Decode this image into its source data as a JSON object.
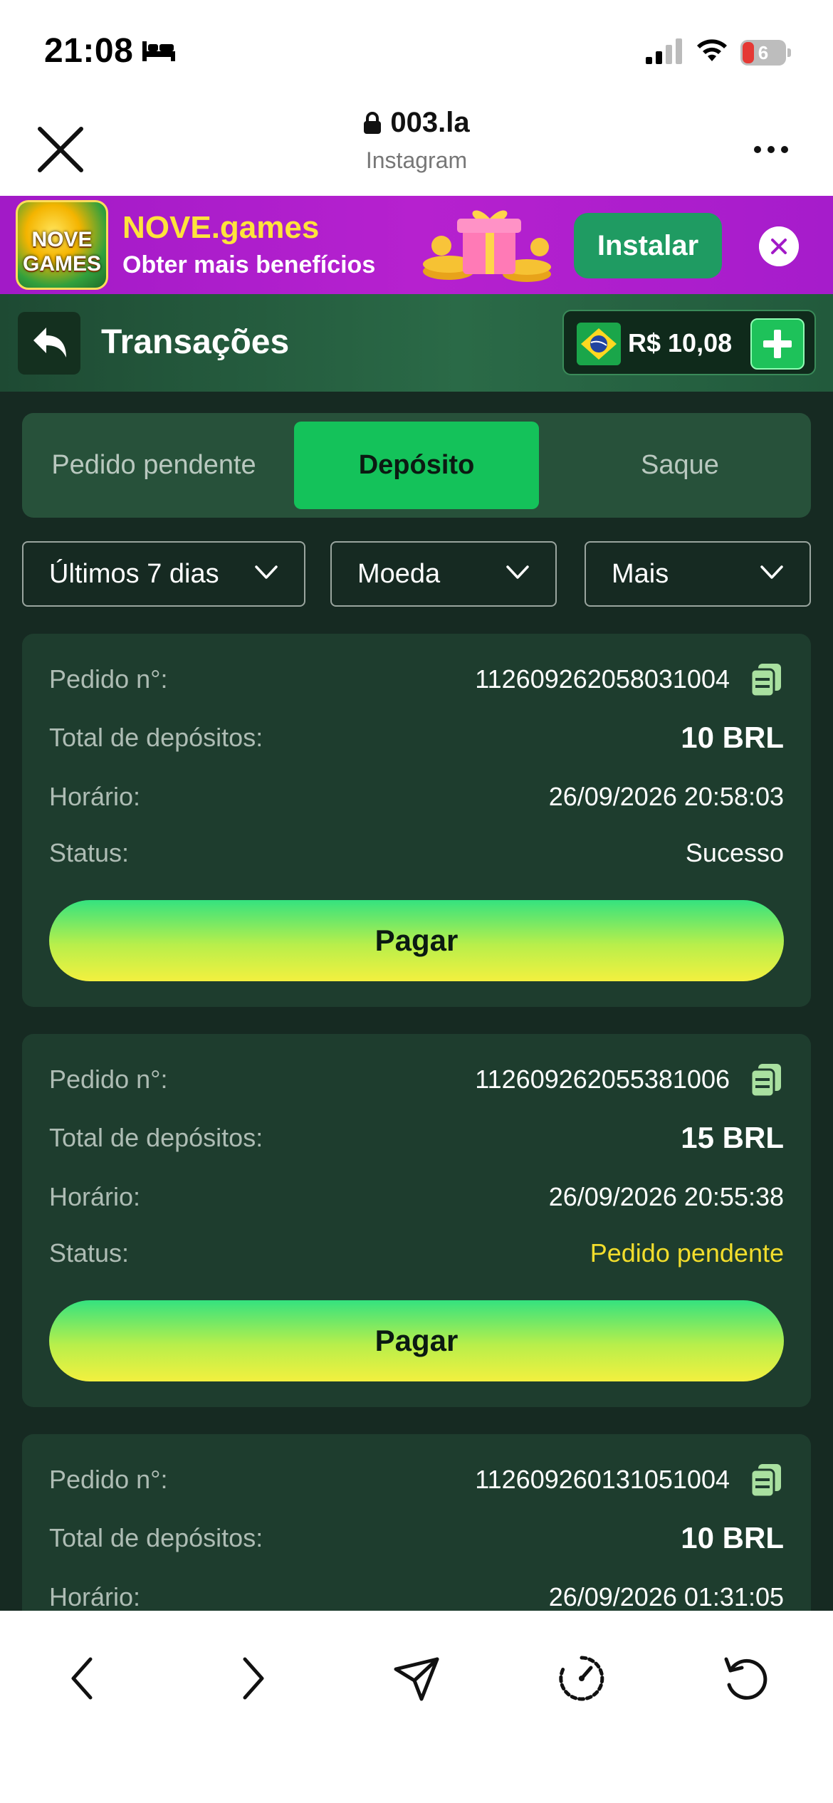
{
  "status_bar": {
    "time": "21:08",
    "battery_level": "6",
    "icons": [
      "bed-icon",
      "signal-icon",
      "wifi-icon",
      "battery-icon"
    ]
  },
  "browser": {
    "url": "003.la",
    "source": "Instagram",
    "icons": [
      "close-icon",
      "lock-icon",
      "more-icon"
    ]
  },
  "promo": {
    "title": "NOVE.games",
    "subtitle": "Obter mais benefícios",
    "logo_text": "NOVE GAMES",
    "install_label": "Instalar",
    "colors": {
      "background": "#a21ac7",
      "title": "#ffe33b",
      "install": "#1f9b62"
    }
  },
  "header": {
    "title": "Transações",
    "balance": "R$ 10,08",
    "icons": [
      "back-icon",
      "brazil-flag-icon",
      "plus-icon"
    ]
  },
  "tabs": [
    {
      "label": "Pedido pendente",
      "active": false
    },
    {
      "label": "Depósito",
      "active": true
    },
    {
      "label": "Saque",
      "active": false
    }
  ],
  "filters": [
    {
      "label": "Últimos 7 dias"
    },
    {
      "label": "Moeda"
    },
    {
      "label": "Mais"
    }
  ],
  "labels": {
    "order_no": "Pedido n°:",
    "total": "Total de depósitos:",
    "time": "Horário:",
    "status": "Status:",
    "pay": "Pagar"
  },
  "transactions": [
    {
      "order_no": "112609262058031004",
      "total": "10 BRL",
      "time": "26/09/2026 20:58:03",
      "status": "Sucesso"
    },
    {
      "order_no": "112609262055381006",
      "total": "15 BRL",
      "time": "26/09/2026 20:55:38",
      "status": "Pedido pendente"
    },
    {
      "order_no": "112609260131051004",
      "total": "10 BRL",
      "time": "26/09/2026 01:31:05",
      "status": ""
    }
  ],
  "colors": {
    "accent": "#14c25a",
    "background": "#162a22",
    "card": "#1e3d2e",
    "pending": "#f2dd2c"
  },
  "bottom_bar": {
    "icons": [
      "back-arrow-icon",
      "forward-arrow-icon",
      "share-icon",
      "speed-icon",
      "reload-icon"
    ]
  }
}
